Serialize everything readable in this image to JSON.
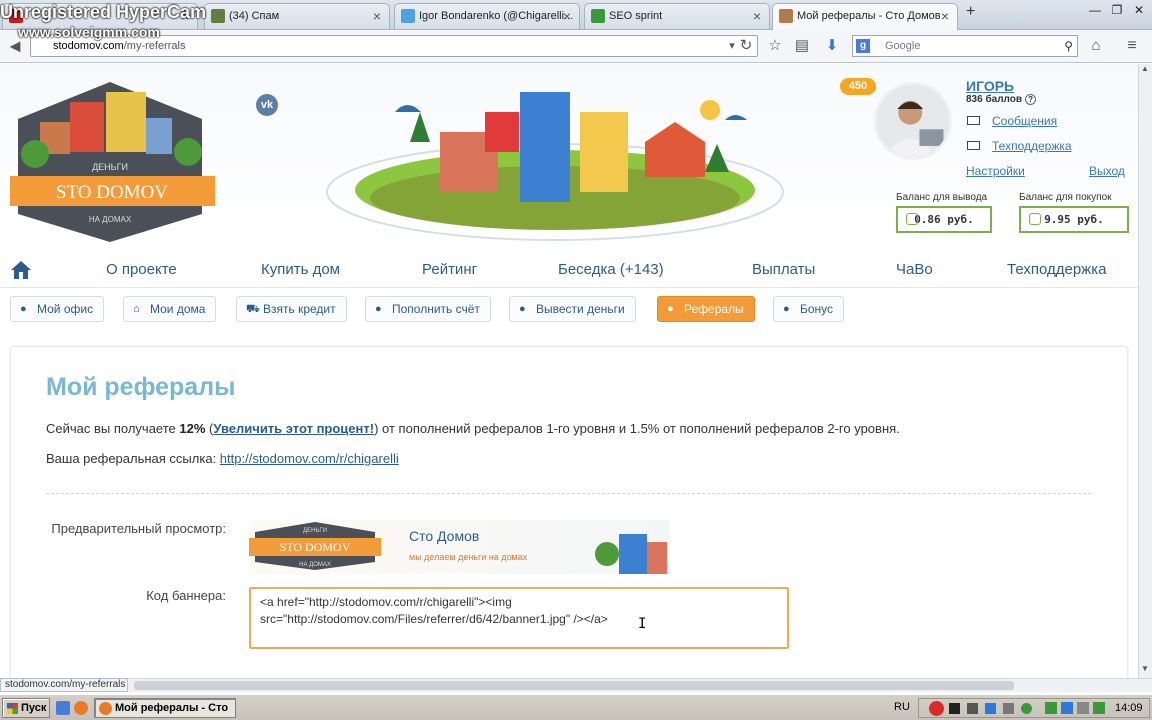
{
  "browser": {
    "tabs": [
      {
        "label": "",
        "favicon_color": "#cc1a1a"
      },
      {
        "label": "(34) Спам",
        "favicon_color": "#5e7f3f"
      },
      {
        "label": "Igor Bondarenko (@Chigarelli...",
        "favicon_color": "#4aa3df"
      },
      {
        "label": "SEO sprint",
        "favicon_color": "#3a9a3a"
      },
      {
        "label": "Мой рефералы - Сто Домов",
        "favicon_color": "#b07a4a"
      }
    ],
    "url_host": "stodomov.com",
    "url_path": "/my-referrals",
    "search_engine_icon": "g",
    "search_placeholder": "Google",
    "icons": [
      "back-icon",
      "reload-icon",
      "star-icon",
      "reader-icon",
      "download-icon",
      "home-icon",
      "menu-icon"
    ]
  },
  "watermark": {
    "line1": "Unregistered HyperCam",
    "line2": "www.solveigmm.com"
  },
  "header": {
    "vk_label": "vk",
    "level_badge": "450",
    "user_name": "ИГОРЬ",
    "points": "836 баллов",
    "points_help": "?",
    "messages_link": "Сообщения",
    "support_link": "Техподдержка",
    "settings_link": "Настройки",
    "logout_link": "Выход",
    "balance_withdraw_label": "Баланс для вывода",
    "balance_withdraw_value": "0.86 руб.",
    "balance_purchase_label": "Баланс для покупок",
    "balance_purchase_value": "9.95 руб."
  },
  "logo": {
    "top": "ДЕНЬГИ",
    "main": "STO DOMOV",
    "bottom": "НА ДОМАХ"
  },
  "main_nav": [
    "О проекте",
    "Купить дом",
    "Рейтинг",
    "Беседка (+143)",
    "Выплаты",
    "ЧаВо",
    "Техподдержка"
  ],
  "sub_nav": [
    {
      "label": "Мой офис",
      "icon": "person-icon",
      "active": false
    },
    {
      "label": "Мои дома",
      "icon": "house-icon",
      "active": false
    },
    {
      "label": "Взять кредит",
      "icon": "cart-icon",
      "active": false
    },
    {
      "label": "Пополнить счёт",
      "icon": "moneybag-icon",
      "active": false
    },
    {
      "label": "Вывести деньги",
      "icon": "piggybank-icon",
      "active": false
    },
    {
      "label": "Рефералы",
      "icon": "users-icon",
      "active": true
    },
    {
      "label": "Бонус",
      "icon": "bonus-bag-icon",
      "active": false
    }
  ],
  "content": {
    "title": "Мой рефералы",
    "p1_before": "Сейчас вы получаете ",
    "p1_percent": "12%",
    "p1_open": " (",
    "p1_link": "Увеличить этот процент!",
    "p1_close": ")",
    "p1_after": " от пополнений рефералов 1-го уровня и 1.5% от пополнений рефералов 2-го уровня.",
    "p2_label": "Ваша реферальная ссылка: ",
    "p2_link": "http://stodomov.com/r/chigarelli",
    "preview_label": "Предварительный просмотр:",
    "banner_title": "Сто Домов",
    "banner_subtitle": "мы делаем деньги на домах",
    "code_label": "Код баннера:",
    "code_value": "<a href=\"http://stodomov.com/r/chigarelli\"><img src=\"http://stodomov.com/Files/referrer/d6/42/banner1.jpg\" /></a>"
  },
  "status_url": "stodomov.com/my-referrals",
  "taskbar": {
    "start": "Пуск",
    "task": "Мой рефералы - Сто ...",
    "lang": "RU",
    "clock": "14:09"
  },
  "colors": {
    "accent_orange": "#f29b38",
    "link_blue": "#2b5c8c",
    "title_blue": "#78b8d6",
    "balance_green": "#7cae4e"
  }
}
